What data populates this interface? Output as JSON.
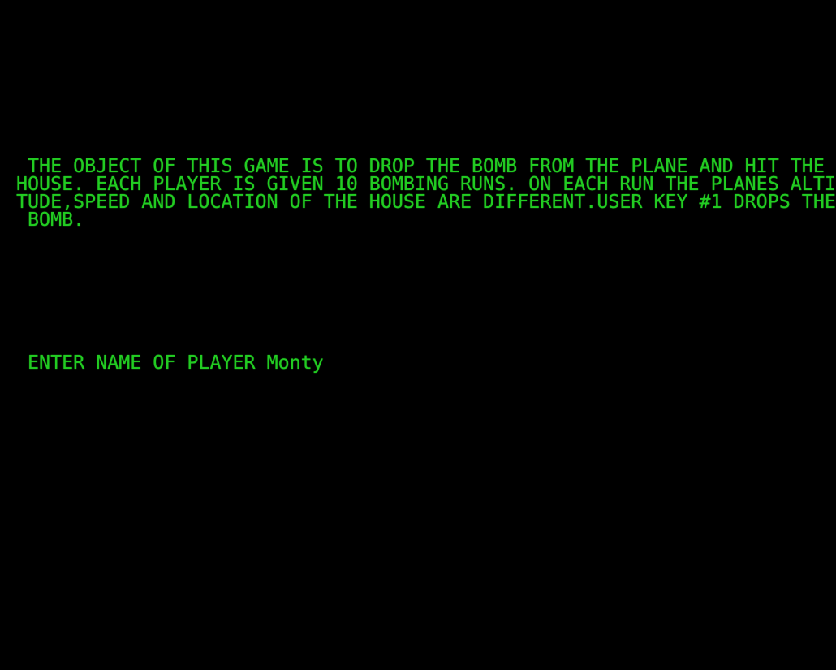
{
  "terminal": {
    "foreground_color": "#22cc22",
    "background_color": "#000000",
    "intro_lines": [
      " THE OBJECT OF THIS GAME IS TO DROP THE BOMB FROM THE PLANE AND HIT THE",
      "HOUSE. EACH PLAYER IS GIVEN 10 BOMBING RUNS. ON EACH RUN THE PLANES ALTI",
      "TUDE,SPEED AND LOCATION OF THE HOUSE ARE DIFFERENT.USER KEY #1 DROPS THE",
      " BOMB."
    ],
    "prompt": {
      "label": " ENTER NAME OF PLAYER ",
      "value": "Monty"
    }
  }
}
